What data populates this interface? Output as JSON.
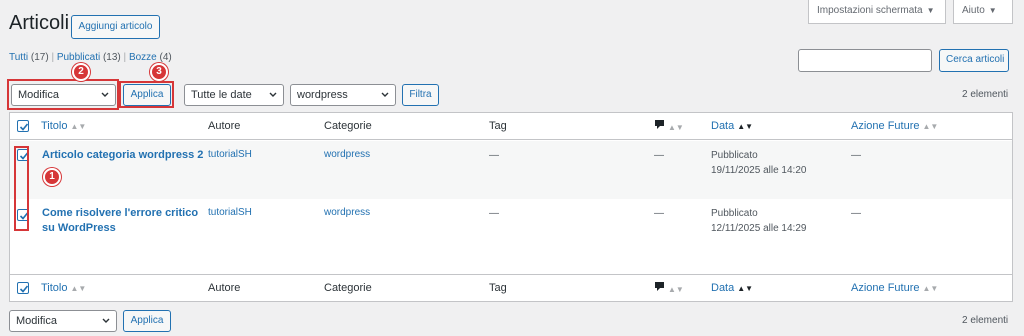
{
  "page": {
    "title": "Articoli",
    "add_new_label": "Aggiungi articolo"
  },
  "top_tabs": {
    "screen_options": "Impostazioni schermata",
    "help": "Aiuto"
  },
  "filters_views": {
    "all": "Tutti",
    "all_count": "(17)",
    "published": "Pubblicati",
    "published_count": "(13)",
    "drafts": "Bozze",
    "drafts_count": "(4)",
    "separator": "|"
  },
  "search": {
    "value": "",
    "button": "Cerca articoli"
  },
  "bulk_top": {
    "action_selected": "Modifica",
    "apply": "Applica",
    "date_filter": "Tutte le date",
    "category_filter": "wordpress",
    "filter_button": "Filtra",
    "count": "2 elementi"
  },
  "columns": {
    "title": "Titolo",
    "author": "Autore",
    "categories": "Categorie",
    "tags": "Tag",
    "date": "Data",
    "future_action": "Azione Future"
  },
  "rows": [
    {
      "title": "Articolo categoria wordpress 2",
      "author": "tutorialSH",
      "category": "wordpress",
      "tags": "—",
      "comments": "—",
      "status": "Pubblicato",
      "date": "19/11/2025 alle 14:20",
      "future_action": "—",
      "checked": true
    },
    {
      "title_line1": "Come risolvere l'errore critico",
      "title_line2": "su WordPress",
      "author": "tutorialSH",
      "category": "wordpress",
      "tags": "—",
      "comments": "—",
      "status": "Pubblicato",
      "date": "12/11/2025 alle 14:29",
      "future_action": "—",
      "checked": true
    }
  ],
  "bulk_bottom": {
    "action_selected": "Modifica",
    "apply": "Applica",
    "count": "2 elementi"
  },
  "annotations": {
    "badge_1": "1",
    "badge_2": "2",
    "badge_3": "3"
  },
  "colors": {
    "accent": "#2271b1",
    "highlight": "#d63638",
    "background": "#f0f0f1"
  }
}
